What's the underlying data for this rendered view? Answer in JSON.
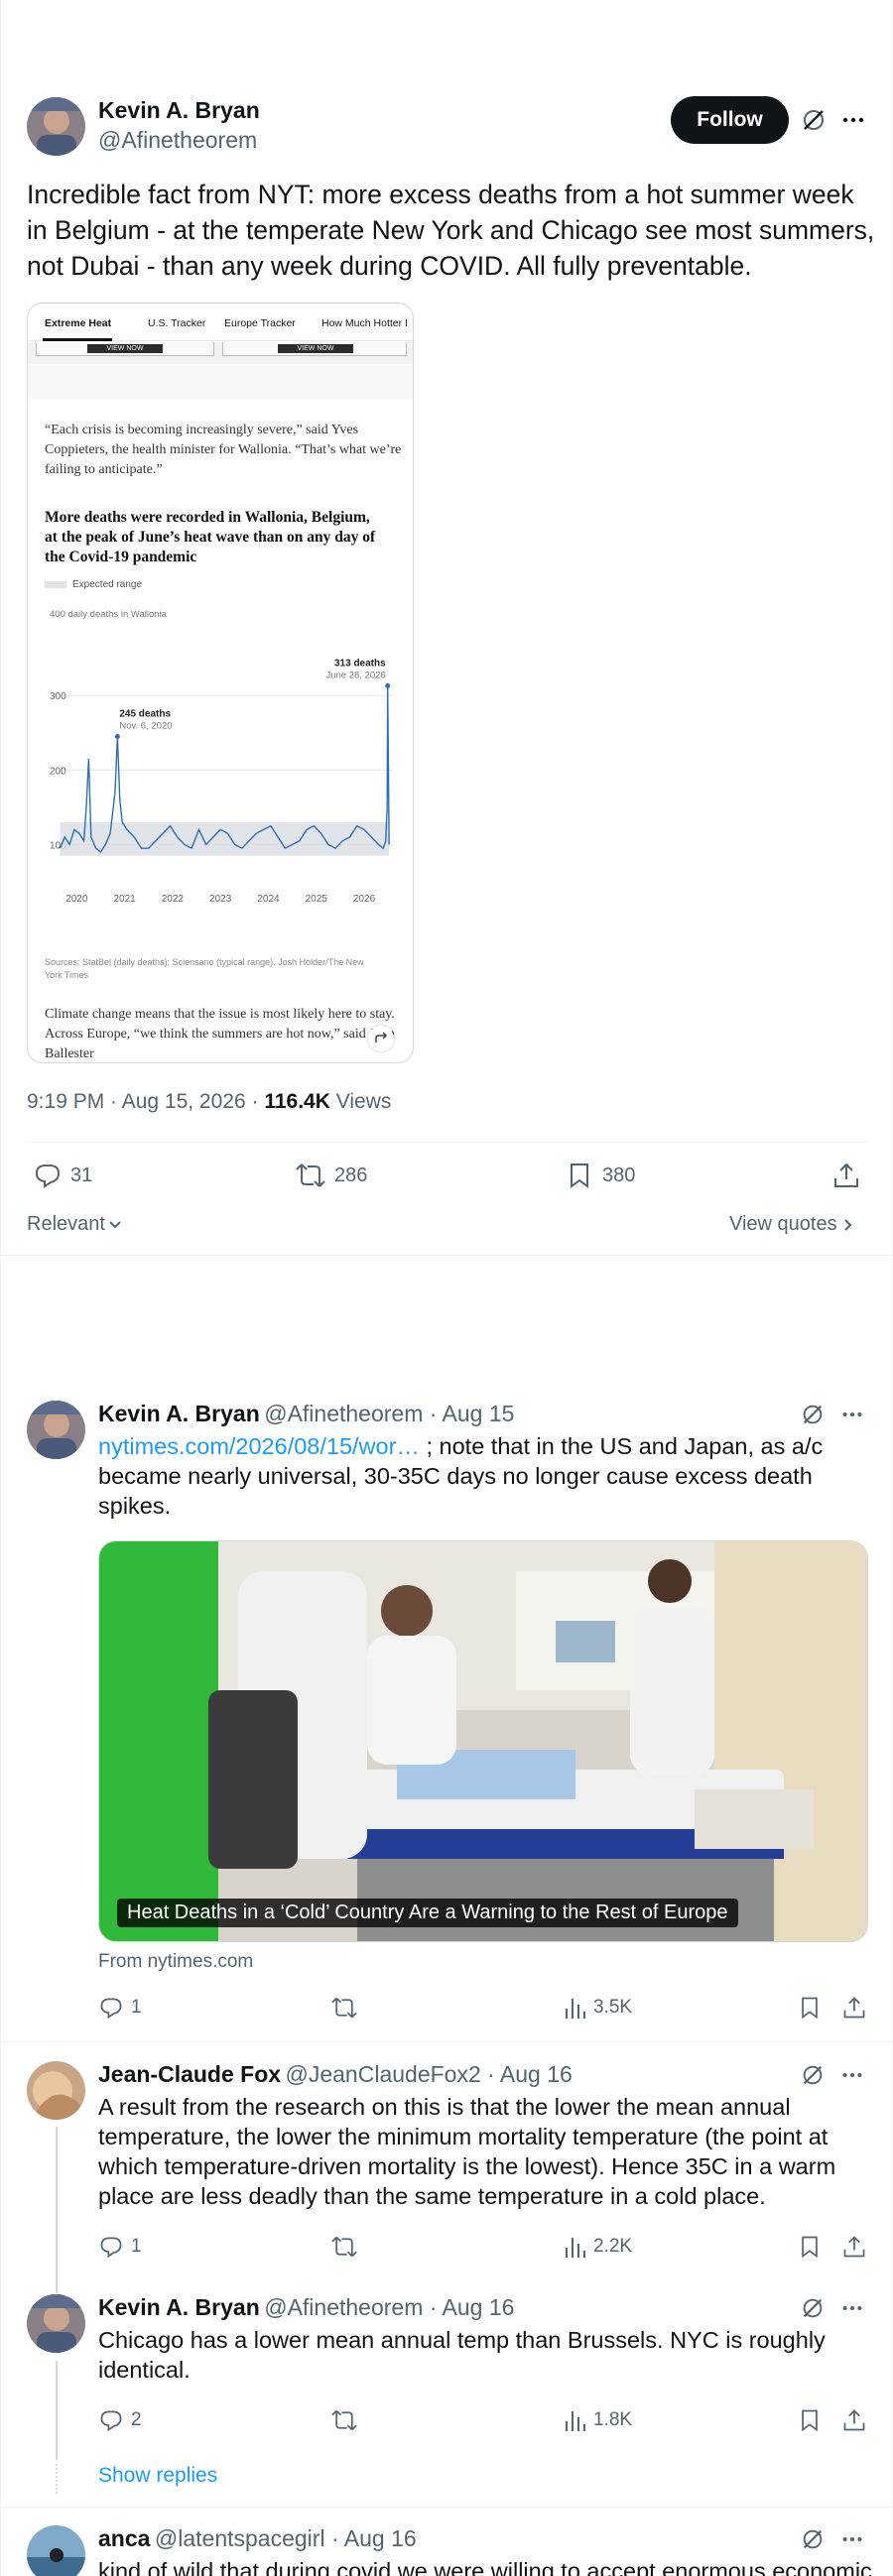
{
  "main_post": {
    "author_name": "Kevin A. Bryan",
    "author_handle": "@Afinetheorem",
    "follow_label": "Follow",
    "text": "Incredible fact from NYT: more excess deaths from a hot summer week in Belgium - at the temperate New York and Chicago see most summers, not Dubai - than any week during COVID. All fully preventable.",
    "timestamp": "9:19 PM · Aug 15, 2026 · ",
    "views_count": "116.4K",
    "views_label": " Views",
    "replies": "31",
    "reposts": "286",
    "bookmarks": "380",
    "sort_label": "Relevant",
    "view_quotes_label": "View quotes"
  },
  "embedded_article": {
    "tabs": [
      "Extreme Heat",
      "U.S. Tracker",
      "Europe Tracker",
      "How Much Hotter I"
    ],
    "view_now": "VIEW NOW",
    "quote": "“Each crisis is becoming increasingly severe,” said Yves Coppieters, the health minister for Wallonia. “That’s what we’re failing to anticipate.”",
    "headline": "More deaths were recorded in Wallonia, Belgium, at the peak of June’s heat wave than on any day of the Covid-19 pandemic",
    "legend_label": "Expected range",
    "y_unit_label": "400 daily deaths in Wallonia",
    "sources": "Sources: StatBel (daily deaths); Sciensano (typical range). Josh Holder/The New York Times",
    "body_text": "Climate change means that the issue is most likely here to stay. Across Europe, “we think the summers are hot now,” said Joan Ballester"
  },
  "chart_data": {
    "type": "line",
    "title": "More deaths were recorded in Wallonia, Belgium, at the peak of June’s heat wave than on any day of the Covid-19 pandemic",
    "ylabel": "daily deaths in Wallonia",
    "x_ticks": [
      "2020",
      "2021",
      "2022",
      "2023",
      "2024",
      "2025",
      "2026"
    ],
    "y_ticks": [
      100,
      200,
      300
    ],
    "ylim": [
      50,
      400
    ],
    "xlim": [
      2019.6,
      2026.6
    ],
    "series": [
      {
        "name": "Daily deaths",
        "x": [
          2019.65,
          2019.75,
          2019.85,
          2019.95,
          2020.05,
          2020.15,
          2020.2,
          2020.25,
          2020.3,
          2020.4,
          2020.5,
          2020.6,
          2020.7,
          2020.8,
          2020.85,
          2020.9,
          2020.95,
          2021.05,
          2021.2,
          2021.35,
          2021.5,
          2021.65,
          2021.8,
          2021.95,
          2022.1,
          2022.25,
          2022.4,
          2022.55,
          2022.7,
          2022.85,
          2023.0,
          2023.15,
          2023.3,
          2023.45,
          2023.6,
          2023.75,
          2023.9,
          2024.05,
          2024.2,
          2024.35,
          2024.5,
          2024.65,
          2024.8,
          2024.95,
          2025.1,
          2025.25,
          2025.4,
          2025.55,
          2025.7,
          2025.85,
          2026.0,
          2026.15,
          2026.3,
          2026.4,
          2026.45,
          2026.48,
          2026.49,
          2026.52
        ],
        "y": [
          95,
          110,
          100,
          120,
          115,
          105,
          150,
          215,
          110,
          95,
          90,
          100,
          115,
          170,
          245,
          160,
          130,
          120,
          110,
          95,
          95,
          105,
          115,
          125,
          110,
          100,
          95,
          120,
          100,
          110,
          120,
          115,
          100,
          95,
          105,
          115,
          120,
          125,
          110,
          95,
          100,
          105,
          120,
          125,
          115,
          100,
          95,
          105,
          110,
          125,
          120,
          110,
          100,
          95,
          105,
          150,
          313,
          100
        ]
      }
    ],
    "annotations": [
      {
        "label": "245 deaths",
        "sublabel": "Nov. 6, 2020",
        "x": 2020.85,
        "y": 245
      },
      {
        "label": "313 deaths",
        "sublabel": "June 28, 2026",
        "x": 2026.49,
        "y": 313
      }
    ],
    "expected_range": {
      "lower": 85,
      "upper": 130
    },
    "grid": true
  },
  "reply1": {
    "author_name": "Kevin A. Bryan",
    "author_handle": "@Afinetheorem",
    "date": " · Aug 15",
    "link_text": "nytimes.com/2026/08/15/wor…",
    "text_after_link": " ; note that in the US and Japan, as a/c became nearly universal, 30-35C days no longer cause excess death spikes.",
    "card_caption": "Heat Deaths in a ‘Cold’ Country Are a Warning to the Rest of Europe",
    "card_source": "From nytimes.com",
    "replies": "1",
    "views": "3.5K"
  },
  "reply2": {
    "author_name": "Jean-Claude Fox",
    "author_handle": "@JeanClaudeFox2",
    "date": " · Aug 16",
    "text": "A result from the research on this is that the lower the mean annual temperature, the lower the minimum mortality temperature (the point at which temperature-driven mortality is the lowest). Hence 35C in a warm place are less deadly than the same temperature in a cold place.",
    "replies": "1",
    "views": "2.2K"
  },
  "reply3": {
    "author_name": "Kevin A. Bryan",
    "author_handle": "@Afinetheorem",
    "date": " · Aug 16",
    "text": "Chicago has a lower mean annual temp than Brussels. NYC is roughly identical.",
    "replies": "2",
    "views": "1.8K",
    "show_replies_label": "Show replies"
  },
  "reply4": {
    "author_name": "anca",
    "author_handle": "@latentspacegirl",
    "date": " · Aug 16",
    "text": "kind of wild that during covid we were willing to accept enormous economic"
  },
  "colors": {
    "accent": "#1d9bf0",
    "text": "#0f1419",
    "secondary": "#536471",
    "chart_line": "#2f6db5"
  }
}
